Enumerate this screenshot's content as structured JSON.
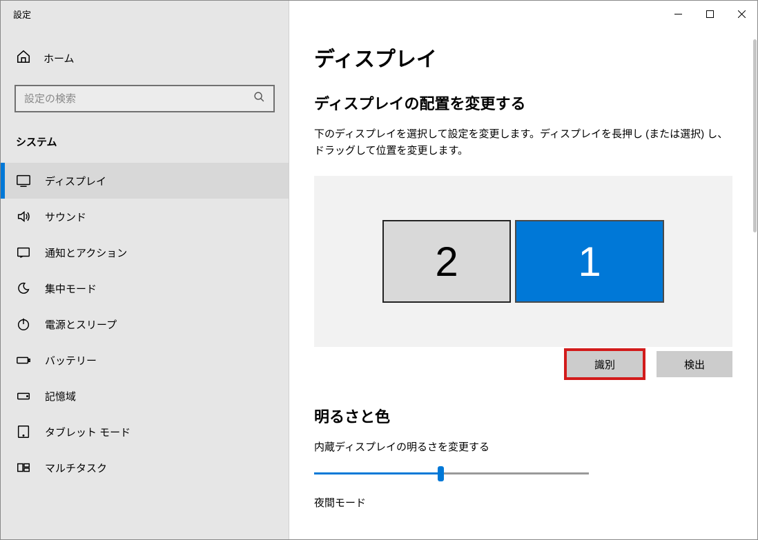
{
  "window": {
    "title": "設定"
  },
  "sidebar": {
    "home": "ホーム",
    "search_placeholder": "設定の検索",
    "category": "システム",
    "items": [
      {
        "label": "ディスプレイ",
        "active": true
      },
      {
        "label": "サウンド"
      },
      {
        "label": "通知とアクション"
      },
      {
        "label": "集中モード"
      },
      {
        "label": "電源とスリープ"
      },
      {
        "label": "バッテリー"
      },
      {
        "label": "記憶域"
      },
      {
        "label": "タブレット モード"
      },
      {
        "label": "マルチタスク"
      }
    ]
  },
  "main": {
    "title": "ディスプレイ",
    "arrange_heading": "ディスプレイの配置を変更する",
    "arrange_desc": "下のディスプレイを選択して設定を変更します。ディスプレイを長押し (または選択) し、ドラッグして位置を変更します。",
    "monitors": {
      "m1": "1",
      "m2": "2"
    },
    "identify_btn": "識別",
    "detect_btn": "検出",
    "brightness_heading": "明るさと色",
    "brightness_label": "内蔵ディスプレイの明るさを変更する",
    "night_mode_label": "夜間モード"
  }
}
